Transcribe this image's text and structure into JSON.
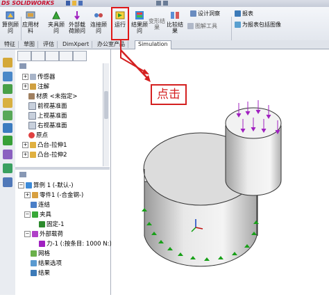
{
  "app": {
    "logo_text": "DS SOLIDWORKS"
  },
  "ribbon": {
    "buttons": [
      {
        "label": "算例顾问",
        "icon": "study-advisor-icon"
      },
      {
        "label": "应用材料",
        "icon": "apply-material-icon"
      },
      {
        "label": "夹具顾问",
        "icon": "fixtures-advisor-icon"
      },
      {
        "label": "外部载荷顾问",
        "icon": "external-loads-advisor-icon"
      },
      {
        "label": "连接顾问",
        "icon": "connections-advisor-icon"
      },
      {
        "label": "运行",
        "icon": "run-icon"
      },
      {
        "label": "结果顾问",
        "icon": "results-advisor-icon"
      },
      {
        "label": "变形结果",
        "icon": "deformed-result-icon"
      },
      {
        "label": "比较结果",
        "icon": "compare-results-icon"
      },
      {
        "label": "图解工具",
        "icon": "plot-tools-icon"
      }
    ],
    "right_items": [
      {
        "label": "设计洞察",
        "icon": "design-insight-icon"
      },
      {
        "label": "报表",
        "icon": "report-icon"
      },
      {
        "label": "为报表包括图像",
        "icon": "include-image-icon"
      }
    ]
  },
  "tabs": [
    "特征",
    "草图",
    "评估",
    "DimXpert",
    "办公室产品",
    "Simulation"
  ],
  "tree": {
    "items": [
      {
        "label": "传感器",
        "icon": "sensor-icon"
      },
      {
        "label": "注解",
        "icon": "annotations-icon"
      },
      {
        "label": "材质 <未指定>",
        "icon": "material-icon"
      },
      {
        "label": "前视基准面",
        "icon": "plane-icon"
      },
      {
        "label": "上视基准面",
        "icon": "plane-icon"
      },
      {
        "label": "右视基准面",
        "icon": "plane-icon"
      },
      {
        "label": "原点",
        "icon": "origin-icon"
      },
      {
        "label": "凸台-拉伸1",
        "icon": "boss-extrude-icon"
      },
      {
        "label": "凸台-拉伸2",
        "icon": "boss-extrude-icon"
      }
    ],
    "study": {
      "title": "算例 1 (-默认-)",
      "items": [
        {
          "label": "零件1 (-合金钢-)",
          "icon": "part-icon",
          "level": 1
        },
        {
          "label": "连结",
          "icon": "connections-icon",
          "level": 1
        },
        {
          "label": "夹具",
          "icon": "fixtures-icon",
          "level": 1
        },
        {
          "label": "固定-1",
          "icon": "fixed-icon",
          "level": 2
        },
        {
          "label": "外部载荷",
          "icon": "external-loads-icon",
          "level": 1
        },
        {
          "label": "力-1 (:按条目: 1000 N:)",
          "icon": "force-icon",
          "level": 2
        },
        {
          "label": "网格",
          "icon": "mesh-icon",
          "level": 1
        },
        {
          "label": "结果选项",
          "icon": "result-options-icon",
          "level": 1
        },
        {
          "label": "结果",
          "icon": "results-icon",
          "level": 1
        }
      ]
    }
  },
  "annotation": {
    "label": "点击"
  },
  "colors": {
    "highlight": "#e01818",
    "tab_active": "#ffffff",
    "load_arrow": "#a020c0",
    "fixture": "#18a018"
  }
}
